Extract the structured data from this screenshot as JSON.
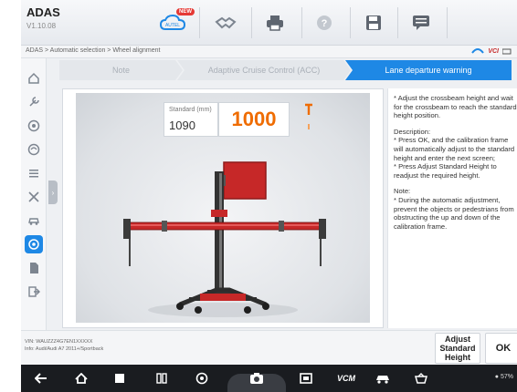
{
  "app": {
    "title": "ADAS",
    "version": "V1.10.08"
  },
  "toolbar": {
    "new_badge": "NEW"
  },
  "breadcrumb": "ADAS > Automatic selection > Wheel alignment",
  "vci": {
    "label": "VCI"
  },
  "steps": [
    {
      "label": "Note",
      "state": "done"
    },
    {
      "label": "Adaptive Cruise Control (ACC)",
      "state": "done"
    },
    {
      "label": "Lane departure warning",
      "state": "active"
    }
  ],
  "measurement": {
    "standard_label": "Standard (mm)",
    "standard_value": "1090",
    "current_value": "1000"
  },
  "instructions": {
    "intro": "* Adjust the crossbeam height and wait for the crossbeam to reach the standard height position.",
    "description": "Description:\n* Press OK, and the calibration frame will automatically adjust to the standard height and enter the next screen;\n* Press Adjust Standard Height to readjust the required height.",
    "note": "Note:\n* During the automatic adjustment, prevent the objects or pedestrians from obstructing the up and down of the calibration frame."
  },
  "vehicle": {
    "vin": "VIN: WAUZZZ4G7EN1XXXXX",
    "info": "Info: Audi/Audi A7 2011+/Sportback"
  },
  "buttons": {
    "adjust": "Adjust\nStandard\nHeight",
    "ok": "OK"
  },
  "status": {
    "battery": "57%"
  },
  "colors": {
    "accent": "#1e88e5",
    "current_value": "#ef6c00",
    "frame": "#c62828"
  }
}
